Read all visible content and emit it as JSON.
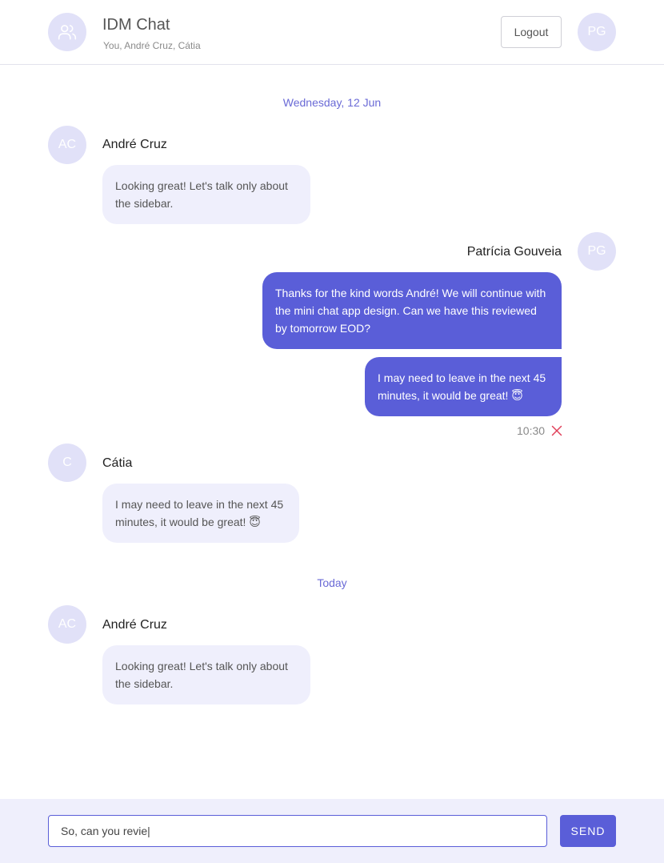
{
  "header": {
    "title": "IDM Chat",
    "members": "You, André Cruz, Cátia",
    "group_icon": "users-icon",
    "logout_label": "Logout",
    "user_initials": "PG"
  },
  "colors": {
    "accent": "#5a5ed8",
    "avatar_bg": "#e1e1f8",
    "incoming_bubble": "#efeffc",
    "error": "#e0405a"
  },
  "date_separators": [
    "Wednesday, 12 Jun",
    "Today"
  ],
  "messages": [
    {
      "sender": "André Cruz",
      "initials": "AC",
      "text": "Looking great! Let's talk only about the sidebar."
    },
    {
      "sender": "Patrícia Gouveia",
      "initials": "PG",
      "text": "Thanks for the kind words André! We will continue with the mini chat app design. Can we have this reviewed by tomorrow EOD?"
    },
    {
      "text": "I may need to leave in the next 45 minutes, it would be great! 😇",
      "time": "10:30",
      "status_icon": "close-icon"
    },
    {
      "sender": "Cátia",
      "initials": "C",
      "text": "I may need to leave in the next 45 minutes, it would be great! 😇"
    },
    {
      "sender": "André Cruz",
      "initials": "AC",
      "text": "Looking great! Let's talk only about the sidebar."
    }
  ],
  "composer": {
    "value": "So, can you revie|",
    "send_label": "SEND"
  }
}
